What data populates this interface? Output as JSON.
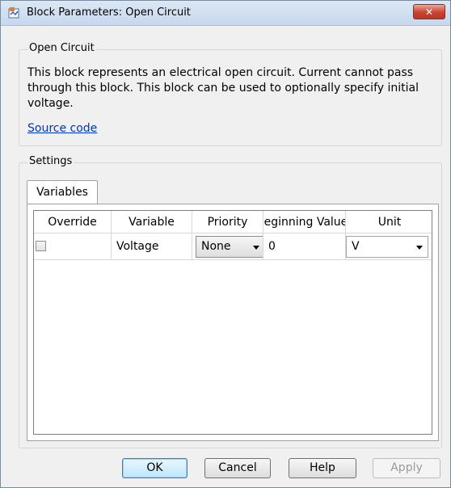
{
  "window": {
    "title": "Block Parameters: Open Circuit",
    "close_label": "✕"
  },
  "block": {
    "group_label": "Open Circuit",
    "description": "This block represents an electrical open circuit. Current cannot pass through this block. This block can be used to optionally specify initial voltage.",
    "source_link": "Source code"
  },
  "settings": {
    "group_label": "Settings",
    "tabs": [
      {
        "label": "Variables"
      }
    ],
    "table": {
      "headers": [
        "Override",
        "Variable",
        "Priority",
        "Beginning Value",
        "Unit"
      ],
      "rows": [
        {
          "override_checked": false,
          "variable": "Voltage",
          "priority": "None",
          "beginning_value": "0",
          "unit": "V"
        }
      ]
    }
  },
  "buttons": {
    "ok": "OK",
    "cancel": "Cancel",
    "help": "Help",
    "apply": "Apply"
  },
  "colors": {
    "link": "#0033cc",
    "close_button": "#c8432f",
    "default_button_border": "#3c7fb1"
  },
  "icons": {
    "app": "simulink-block-icon",
    "close": "close-icon",
    "dropdown": "chevron-down-icon"
  }
}
